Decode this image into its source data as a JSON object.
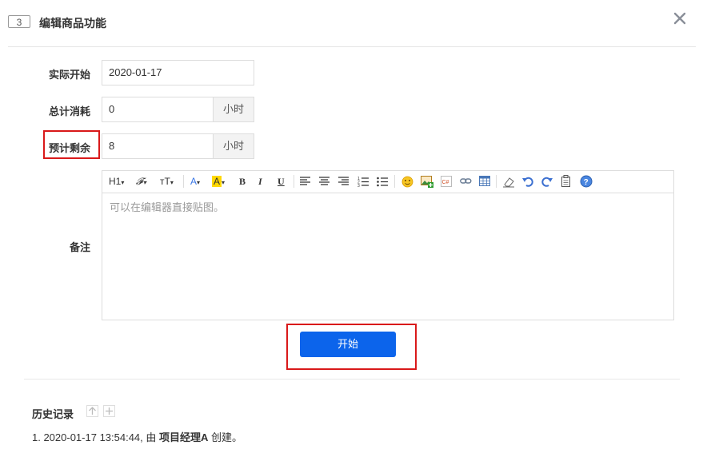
{
  "header": {
    "task_id": "3",
    "title": "编辑商品功能",
    "close_icon": "close-icon"
  },
  "form": {
    "actual_start": {
      "label": "实际开始",
      "value": "2020-01-17"
    },
    "total_consumed": {
      "label": "总计消耗",
      "value": "0",
      "unit": "小时"
    },
    "estimated_left": {
      "label": "预计剩余",
      "value": "8",
      "unit": "小时"
    },
    "remark": {
      "label": "备注",
      "placeholder": "可以在编辑器直接贴图。"
    }
  },
  "toolbar": {
    "heading": "H1",
    "font_family": "𝓕",
    "font_size": "тT",
    "font_color": "A",
    "bg_color": "A",
    "bold": "B",
    "italic": "I",
    "underline": "U",
    "code": "C#"
  },
  "actions": {
    "start_label": "开始"
  },
  "history": {
    "title": "历史记录",
    "items": [
      {
        "prefix": "1. 2020-01-17 13:54:44, 由 ",
        "actor": "项目经理A",
        "suffix": " 创建。"
      }
    ]
  },
  "colors": {
    "primary": "#0c64eb",
    "highlight_border": "#d9191a"
  }
}
